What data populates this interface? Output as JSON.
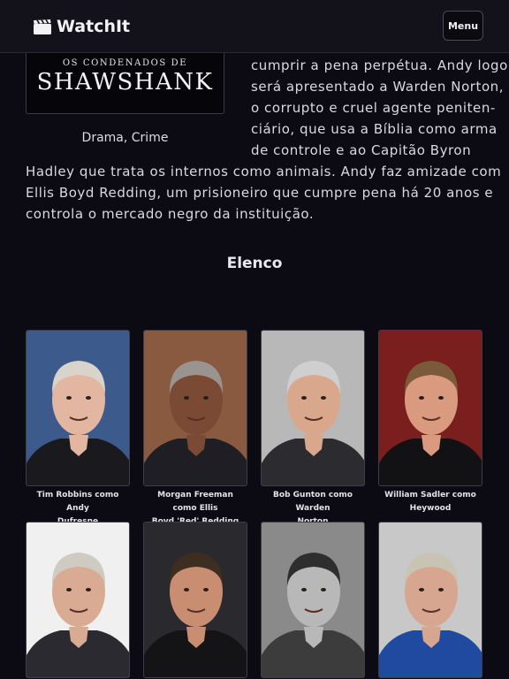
{
  "header": {
    "brand": "WatchIt",
    "menu_label": "Menu"
  },
  "movie": {
    "poster": {
      "top_text": "OS CONDENADOS DE",
      "title_text": "SHAWSHANK"
    },
    "genres": "Drama, Crime",
    "synopsis_lines": [
      "cumprir a pena perpétua. Andy logo",
      "será apresentado a Warden Norton,",
      "o corrupto e cruel agente peniten-",
      "ciário, que usa a Bíblia como arma",
      "de controle e ao Capitão Byron",
      "Hadley que trata os internos como animais. Andy faz amizade com",
      "Ellis Boyd Redding, um prisioneiro que cumpre pena há 20 anos e",
      "controla o mercado negro da instituição."
    ]
  },
  "cast": {
    "title": "Elenco",
    "members": [
      {
        "caption_line1": "Tim Robbins como Andy",
        "caption_line2": "Dufresne",
        "photo": {
          "bg": "#3c5a8c",
          "skin": "#e2b6a0",
          "hair": "#d8d4cc",
          "shirt": "#1a1a1e"
        }
      },
      {
        "caption_line1": "Morgan Freeman como Ellis",
        "caption_line2": "Boyd 'Red' Redding",
        "photo": {
          "bg": "#8a5a40",
          "skin": "#7a4a34",
          "hair": "#9a9490",
          "shirt": "#1e1e24"
        }
      },
      {
        "caption_line1": "Bob Gunton como Warden",
        "caption_line2": "Norton",
        "photo": {
          "bg": "#b8b8b8",
          "skin": "#d9a88c",
          "hair": "#cfcfcf",
          "shirt": "#2c2c30"
        }
      },
      {
        "caption_line1": "William Sadler como",
        "caption_line2": "Heywood",
        "photo": {
          "bg": "#7a1e1e",
          "skin": "#d99a80",
          "hair": "#7a5a3a",
          "shirt": "#121214"
        }
      },
      {
        "caption_line1": "",
        "caption_line2": "",
        "photo": {
          "bg": "#f0f0f0",
          "skin": "#d8ab92",
          "hair": "#cfcac2",
          "shirt": "#2a2a30"
        }
      },
      {
        "caption_line1": "",
        "caption_line2": "",
        "photo": {
          "bg": "#2a2a2e",
          "skin": "#c98e72",
          "hair": "#3e2e22",
          "shirt": "#141416"
        }
      },
      {
        "caption_line1": "",
        "caption_line2": "",
        "photo": {
          "bg": "#8a8a8a",
          "skin": "#b8b8b8",
          "hair": "#2e2e2e",
          "shirt": "#3c3c3c"
        }
      },
      {
        "caption_line1": "",
        "caption_line2": "",
        "photo": {
          "bg": "#c8c8c8",
          "skin": "#d7a690",
          "hair": "#c9c3b4",
          "shirt": "#1f4aa0"
        }
      }
    ]
  }
}
